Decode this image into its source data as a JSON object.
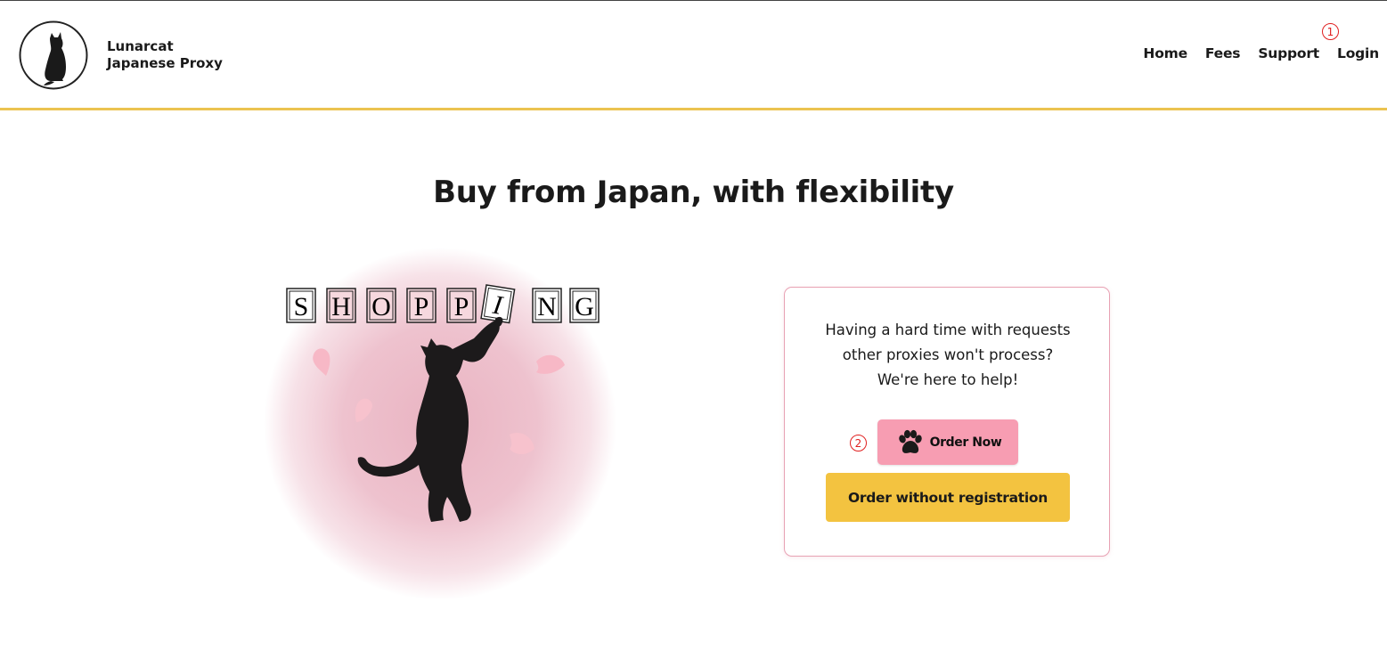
{
  "brand": {
    "line1": "Lunarcat",
    "line2": "Japanese Proxy"
  },
  "nav": {
    "items": [
      "Home",
      "Fees",
      "Support",
      "Login"
    ]
  },
  "markers": [
    "1",
    "2"
  ],
  "hero": {
    "title": "Buy from Japan, with flexibility"
  },
  "illustration": {
    "letters": [
      "S",
      "H",
      "O",
      "P",
      "P",
      "I",
      "N",
      "G"
    ]
  },
  "card": {
    "lines": [
      "Having a hard time with requests",
      "other proxies won't process?",
      "We're here to help!"
    ],
    "order_label": "Order Now",
    "guest_label": "Order without registration"
  },
  "colors": {
    "accent_yellow": "#ebc350",
    "button_yellow": "#f3c340",
    "button_pink": "#f79db2",
    "card_border": "#e8a2b4",
    "marker_red": "#e02020"
  }
}
